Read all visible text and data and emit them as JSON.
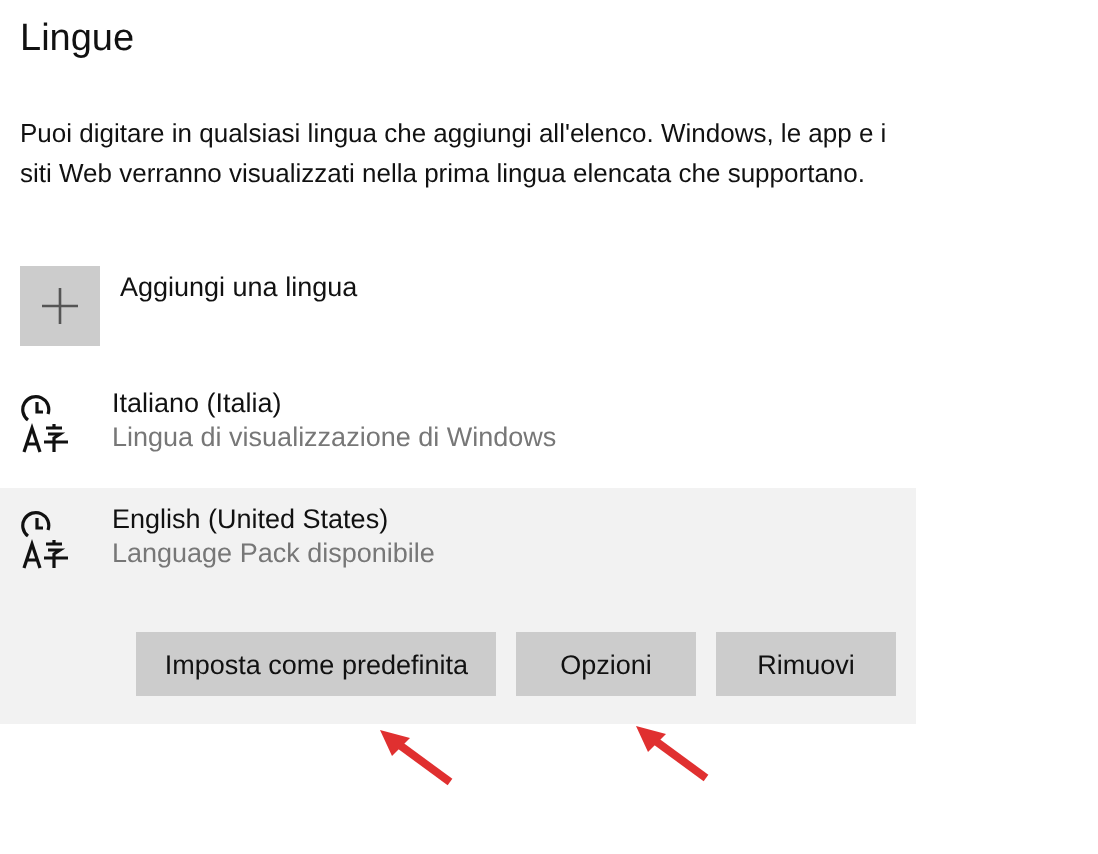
{
  "title": "Lingue",
  "description": "Puoi digitare in qualsiasi lingua che aggiungi all'elenco. Windows, le app e i siti Web verranno visualizzati nella prima lingua elencata che supportano.",
  "add_button": {
    "label": "Aggiungi una lingua"
  },
  "languages": [
    {
      "name": "Italiano (Italia)",
      "status": "Lingua di visualizzazione di Windows",
      "selected": false
    },
    {
      "name": "English (United States)",
      "status": "Language Pack disponibile",
      "selected": true
    }
  ],
  "actions": [
    "Imposta come predefinita",
    "Opzioni",
    "Rimuovi"
  ]
}
